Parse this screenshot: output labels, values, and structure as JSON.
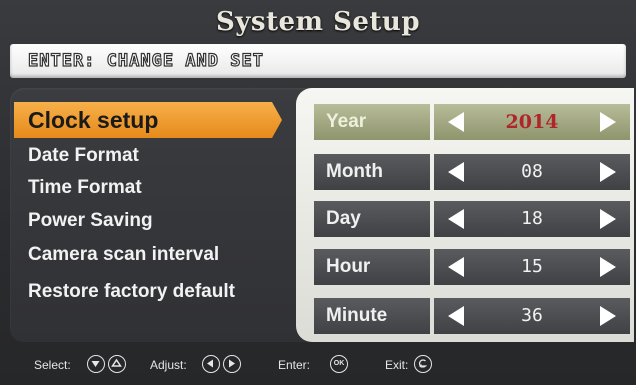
{
  "title": "System Setup",
  "hint": "ENTER: CHANGE AND SET",
  "menu": {
    "items": [
      {
        "label": "Clock setup"
      },
      {
        "label": "Date Format"
      },
      {
        "label": "Time Format"
      },
      {
        "label": "Power Saving"
      },
      {
        "label": "Camera scan interval"
      },
      {
        "label": "Restore factory default"
      }
    ]
  },
  "clock": {
    "rows": [
      {
        "label": "Year",
        "value": "2014"
      },
      {
        "label": "Month",
        "value": "08"
      },
      {
        "label": "Day",
        "value": "18"
      },
      {
        "label": "Hour",
        "value": "15"
      },
      {
        "label": "Minute",
        "value": "36"
      }
    ]
  },
  "footer": {
    "select_label": "Select:",
    "adjust_label": "Adjust:",
    "enter_label": "Enter:",
    "ok_text": "OK",
    "exit_label": "Exit:"
  },
  "colors": {
    "selected_menu": "#f0a035",
    "active_row": "#a3a87f",
    "active_value": "#b0252a"
  }
}
